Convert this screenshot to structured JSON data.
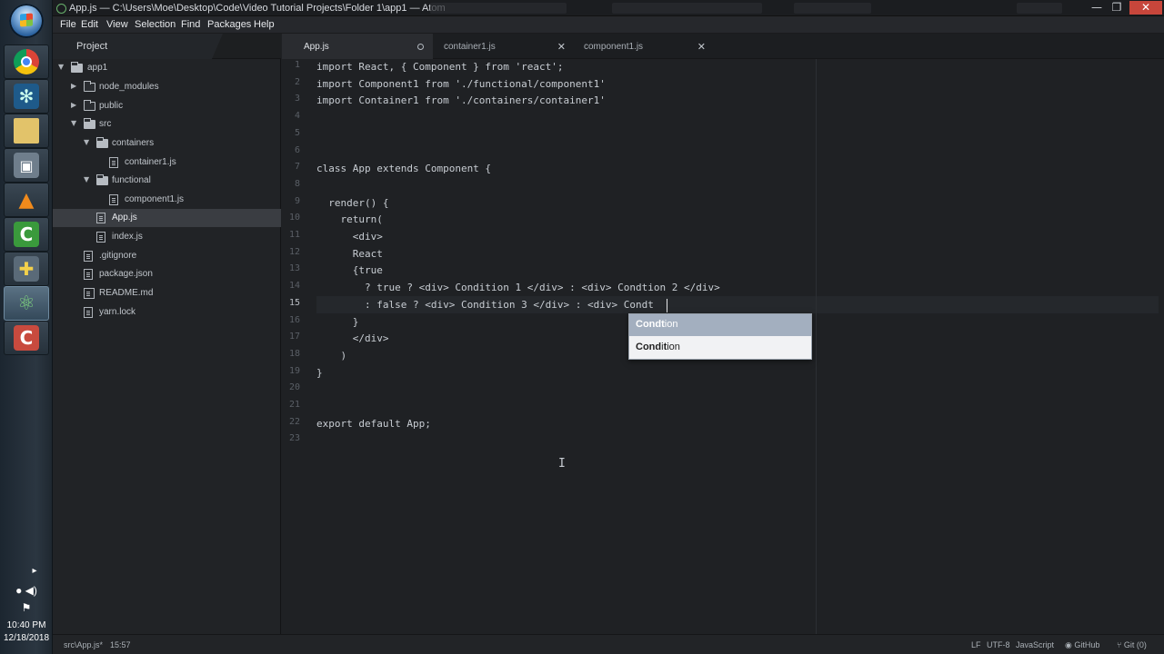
{
  "window": {
    "title": "App.js — C:\\Users\\Moe\\Desktop\\Code\\Video Tutorial Projects\\Folder 1\\app1 — Atom",
    "minimize": "—",
    "maximize": "❐",
    "close": "✕"
  },
  "menu": [
    "File",
    "Edit",
    "View",
    "Selection",
    "Find",
    "Packages",
    "Help"
  ],
  "tree": {
    "header": "Project",
    "rows": [
      {
        "label": "app1",
        "type": "folder",
        "open": true
      },
      {
        "label": "node_modules",
        "type": "folder",
        "open": false
      },
      {
        "label": "public",
        "type": "folder",
        "open": false
      },
      {
        "label": "src",
        "type": "folder",
        "open": true
      },
      {
        "label": "containers",
        "type": "folder",
        "open": true
      },
      {
        "label": "container1.js",
        "type": "file"
      },
      {
        "label": "functional",
        "type": "folder",
        "open": true
      },
      {
        "label": "component1.js",
        "type": "file"
      },
      {
        "label": "App.js",
        "type": "file",
        "selected": true
      },
      {
        "label": "index.js",
        "type": "file"
      },
      {
        "label": ".gitignore",
        "type": "file"
      },
      {
        "label": "package.json",
        "type": "file"
      },
      {
        "label": "README.md",
        "type": "file"
      },
      {
        "label": "yarn.lock",
        "type": "file"
      }
    ]
  },
  "tabs": [
    {
      "label": "App.js",
      "active": true,
      "modified": true
    },
    {
      "label": "container1.js",
      "close": "✕"
    },
    {
      "label": "component1.js",
      "close": "✕"
    }
  ],
  "code": {
    "line_numbers": [
      "1",
      "2",
      "3",
      "4",
      "5",
      "6",
      "7",
      "8",
      "9",
      "10",
      "11",
      "12",
      "13",
      "14",
      "15",
      "16",
      "17",
      "18",
      "19",
      "20",
      "21",
      "22",
      "23"
    ],
    "current_line": "15",
    "lines": [
      "import React, { Component } from 'react';",
      "import Component1 from './functional/component1'",
      "import Container1 from './containers/container1'",
      "",
      "",
      "",
      "class App extends Component {",
      "",
      "  render() {",
      "    return(",
      "      <div>",
      "      React",
      "      {true",
      "        ? true ? <div> Condition 1 </div> : <div> Condtion 2 </div>",
      "        : false ? <div> Condition 3 </div> : <div> Condt",
      "      }",
      "      </div>",
      "    )",
      "}",
      "",
      "",
      "export default App;",
      ""
    ]
  },
  "autocomplete": {
    "items": [
      {
        "match": "Condt",
        "rest": "ion"
      },
      {
        "match": "Cond",
        "mid": "i",
        "match2": "t",
        "rest": "ion"
      }
    ]
  },
  "taskbar": {
    "time": "10:40 PM",
    "date": "12/18/2018",
    "arrow": "▸"
  },
  "status": {
    "path": "src\\App.js*",
    "cursor": "15:57",
    "line_ending": "LF",
    "encoding": "UTF-8",
    "grammar": "JavaScript",
    "github": "GitHub",
    "git": "Git (0)"
  }
}
